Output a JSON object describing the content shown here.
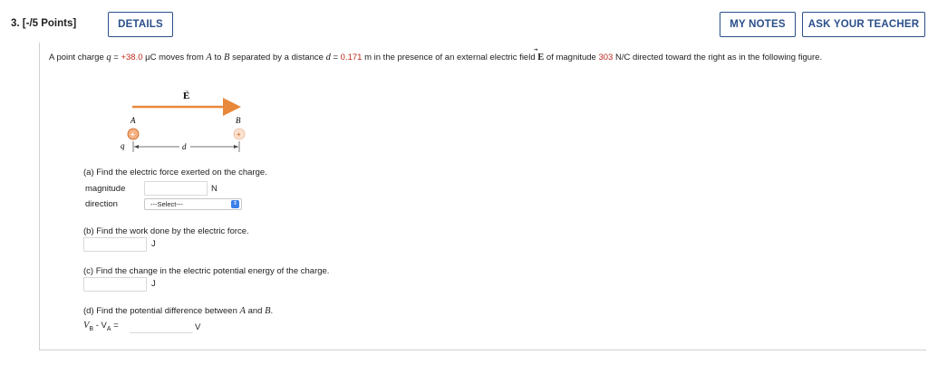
{
  "header": {
    "question_number": "3.",
    "points": "[-/5 Points]",
    "details_label": "DETAILS",
    "notes_label": "MY NOTES",
    "teacher_label": "ASK YOUR TEACHER"
  },
  "prompt": {
    "t1": "A point charge ",
    "q_sym": "q",
    "t2": " = ",
    "q_val": "+38.0",
    "t3": " µC moves from ",
    "A": "A",
    "t4": " to ",
    "B": "B",
    "t5": " separated by a distance ",
    "d_sym": "d",
    "t6": " = ",
    "d_val": "0.171",
    "t7": " m in the presence of an external electric field ",
    "E": "E",
    "E_arrow": "⃗",
    "t8": " of magnitude ",
    "E_val": "303",
    "t9": " N/C directed toward the right as in the following figure."
  },
  "figure": {
    "E_label": "E",
    "A_label": "A",
    "B_label": "B",
    "q_label": "q",
    "d_label": "d",
    "plus": "+",
    "colors": {
      "arrow": "#e8883a",
      "charge_fill": "#f4b183",
      "charge_fill_light": "#fbe1d0",
      "charge_stroke": "#c55a11"
    }
  },
  "parts": {
    "a_prompt": "(a) Find the electric force exerted on the charge.",
    "a_mag_label": "magnitude",
    "a_mag_unit": "N",
    "a_dir_label": "direction",
    "a_dir_select": "---Select---",
    "b_prompt": "(b) Find the work done by the electric force.",
    "b_unit": "J",
    "c_prompt": "(c) Find the change in the electric potential energy of the charge.",
    "c_unit": "J",
    "d_prompt_pre": "(d) Find the potential difference between ",
    "d_A": "A",
    "d_and": " and ",
    "d_B": "B",
    "d_dot": ".",
    "d_eq": "V",
    "d_eq_b": "B",
    "d_minus": " - V",
    "d_eq_a": "A",
    "d_equals": " =",
    "d_unit": "V"
  }
}
